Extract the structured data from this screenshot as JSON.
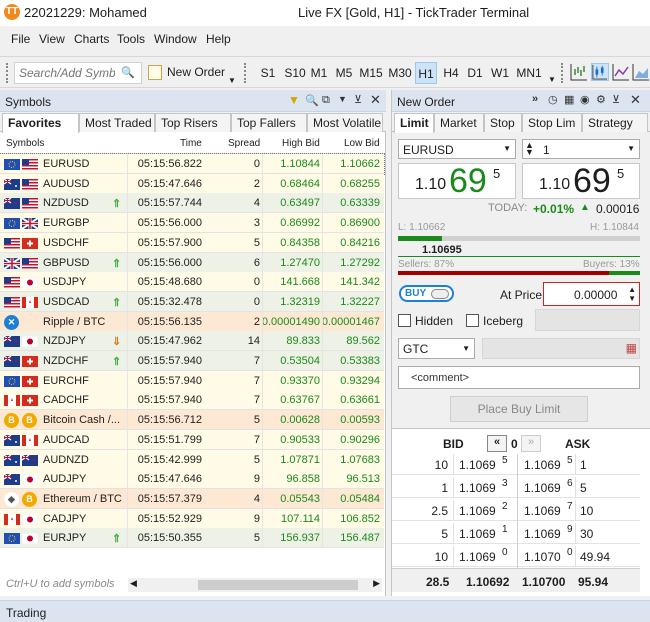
{
  "window": {
    "account": "22021229: Mohamed",
    "title": "Live FX [Gold, H1] - TickTrader Terminal"
  },
  "menu": [
    "File",
    "View",
    "Charts",
    "Tools",
    "Window",
    "Help"
  ],
  "toolbar": {
    "search_placeholder": "Search/Add Symbols",
    "new_order": "New Order",
    "timeframes": [
      "S1",
      "S10",
      "M1",
      "M5",
      "M15",
      "M30",
      "H1",
      "H4",
      "D1",
      "W1",
      "MN1"
    ],
    "active_timeframe": "H1"
  },
  "symbols_panel": {
    "title": "Symbols",
    "tabs": [
      "Favorites",
      "Most Traded",
      "Top Risers",
      "Top Fallers",
      "Most Volatile"
    ],
    "active_tab": "Favorites",
    "columns": [
      "Symbols",
      "Time",
      "Spread",
      "High Bid",
      "Low Bid"
    ],
    "rows": [
      {
        "symbol": "EURUSD",
        "time": "05:15:56.822",
        "spread": "0",
        "high": "1.10844",
        "low": "1.10662",
        "flags": [
          "eu",
          "us"
        ],
        "trend": "",
        "bg": "#fffbe6"
      },
      {
        "symbol": "AUDUSD",
        "time": "05:15:47.646",
        "spread": "2",
        "high": "0.68464",
        "low": "0.68255",
        "flags": [
          "au",
          "us"
        ],
        "trend": "",
        "bg": "#fffbe6"
      },
      {
        "symbol": "NZDUSD",
        "time": "05:15:57.744",
        "spread": "4",
        "high": "0.63497",
        "low": "0.63339",
        "flags": [
          "nz",
          "us"
        ],
        "trend": "up",
        "bg": "#eef1e6"
      },
      {
        "symbol": "EURGBP",
        "time": "05:15:56.000",
        "spread": "3",
        "high": "0.86992",
        "low": "0.86900",
        "flags": [
          "eu",
          "gb"
        ],
        "trend": "",
        "bg": "#fffbe6"
      },
      {
        "symbol": "USDCHF",
        "time": "05:15:57.900",
        "spread": "5",
        "high": "0.84358",
        "low": "0.84216",
        "flags": [
          "us",
          "ch"
        ],
        "trend": "",
        "bg": "#fffbe6"
      },
      {
        "symbol": "GBPUSD",
        "time": "05:15:56.000",
        "spread": "6",
        "high": "1.27470",
        "low": "1.27292",
        "flags": [
          "gb",
          "us"
        ],
        "trend": "up",
        "bg": "#eef1e6"
      },
      {
        "symbol": "USDJPY",
        "time": "05:15:48.680",
        "spread": "0",
        "high": "141.668",
        "low": "141.342",
        "flags": [
          "us",
          "jp"
        ],
        "trend": "",
        "bg": "#fffbe6"
      },
      {
        "symbol": "USDCAD",
        "time": "05:15:32.478",
        "spread": "0",
        "high": "1.32319",
        "low": "1.32227",
        "flags": [
          "us",
          "ca"
        ],
        "trend": "up",
        "bg": "#eef1e6"
      },
      {
        "symbol": "Ripple / BTC",
        "time": "05:15:56.135",
        "spread": "2",
        "high": "0.00001490",
        "low": "0.00001467",
        "flags": [
          "xrp"
        ],
        "trend": "",
        "bg": "#fde8d4"
      },
      {
        "symbol": "NZDJPY",
        "time": "05:15:47.962",
        "spread": "14",
        "high": "89.833",
        "low": "89.562",
        "flags": [
          "nz",
          "jp"
        ],
        "trend": "down",
        "bg": "#eef1e6"
      },
      {
        "symbol": "NZDCHF",
        "time": "05:15:57.940",
        "spread": "7",
        "high": "0.53504",
        "low": "0.53383",
        "flags": [
          "nz",
          "ch"
        ],
        "trend": "up",
        "bg": "#eef1e6"
      },
      {
        "symbol": "EURCHF",
        "time": "05:15:57.940",
        "spread": "7",
        "high": "0.93370",
        "low": "0.93294",
        "flags": [
          "eu",
          "ch"
        ],
        "trend": "",
        "bg": "#fffbe6"
      },
      {
        "symbol": "CADCHF",
        "time": "05:15:57.940",
        "spread": "7",
        "high": "0.63767",
        "low": "0.63661",
        "flags": [
          "ca",
          "ch"
        ],
        "trend": "",
        "bg": "#fffbe6"
      },
      {
        "symbol": "Bitcoin Cash /...",
        "time": "05:15:56.712",
        "spread": "5",
        "high": "0.00628",
        "low": "0.00593",
        "flags": [
          "bch",
          "btc"
        ],
        "trend": "",
        "bg": "#fde8d4"
      },
      {
        "symbol": "AUDCAD",
        "time": "05:15:51.799",
        "spread": "7",
        "high": "0.90533",
        "low": "0.90296",
        "flags": [
          "au",
          "ca"
        ],
        "trend": "",
        "bg": "#fffbe6"
      },
      {
        "symbol": "AUDNZD",
        "time": "05:15:42.999",
        "spread": "5",
        "high": "1.07871",
        "low": "1.07683",
        "flags": [
          "au",
          "nz"
        ],
        "trend": "",
        "bg": "#fffbe6"
      },
      {
        "symbol": "AUDJPY",
        "time": "05:15:47.646",
        "spread": "9",
        "high": "96.858",
        "low": "96.513",
        "flags": [
          "au",
          "jp"
        ],
        "trend": "",
        "bg": "#fffbe6"
      },
      {
        "symbol": "Ethereum / BTC",
        "time": "05:15:57.379",
        "spread": "4",
        "high": "0.05543",
        "low": "0.05484",
        "flags": [
          "eth",
          "btc"
        ],
        "trend": "",
        "bg": "#fde8d4"
      },
      {
        "symbol": "CADJPY",
        "time": "05:15:52.929",
        "spread": "9",
        "high": "107.114",
        "low": "106.852",
        "flags": [
          "ca",
          "jp"
        ],
        "trend": "",
        "bg": "#fffbe6"
      },
      {
        "symbol": "EURJPY",
        "time": "05:15:50.355",
        "spread": "5",
        "high": "156.937",
        "low": "156.487",
        "flags": [
          "eu",
          "jp"
        ],
        "trend": "up",
        "bg": "#eef1e6"
      }
    ],
    "hint": "Ctrl+U to add symbols"
  },
  "order_panel": {
    "title": "New Order",
    "tabs": [
      "Limit",
      "Market",
      "Stop",
      "Stop Lim",
      "Strategy"
    ],
    "active_tab": "Limit",
    "symbol": "EURUSD",
    "quantity": "1",
    "bid": {
      "pre": "1.10",
      "big": "69",
      "sup": "5"
    },
    "ask": {
      "pre": "1.10",
      "big": "69",
      "sup": "5"
    },
    "today_label": "TODAY:",
    "today_pct": "+0.01%",
    "today_abs": "0.00016",
    "low_label": "L: 1.10662",
    "high_label": "H: 1.10844",
    "current_price": "1.10695",
    "current_fraction": 0.18,
    "sellers": "Sellers: 87%",
    "buyers": "Buyers: 13%",
    "sellers_fraction": 0.87,
    "buy_toggle": "BUY",
    "at_price_label": "At Price:",
    "at_price_value": "0.00000",
    "hidden_label": "Hidden",
    "iceberg_label": "Iceberg",
    "expiry": "GTC",
    "comment_placeholder": "<comment>",
    "place_button": "Place Buy Limit"
  },
  "order_book": {
    "bid_header": "BID",
    "ask_header": "ASK",
    "depth": "0",
    "rows": [
      {
        "bid_vol": "10",
        "bid_pre": "1.1069",
        "bid_sup": "5",
        "ask_pre": "1.1069",
        "ask_sup": "5",
        "ask_vol": "1"
      },
      {
        "bid_vol": "1",
        "bid_pre": "1.1069",
        "bid_sup": "3",
        "ask_pre": "1.1069",
        "ask_sup": "6",
        "ask_vol": "5"
      },
      {
        "bid_vol": "2.5",
        "bid_pre": "1.1069",
        "bid_sup": "2",
        "ask_pre": "1.1069",
        "ask_sup": "7",
        "ask_vol": "10"
      },
      {
        "bid_vol": "5",
        "bid_pre": "1.1069",
        "bid_sup": "1",
        "ask_pre": "1.1069",
        "ask_sup": "9",
        "ask_vol": "30"
      },
      {
        "bid_vol": "10",
        "bid_pre": "1.1069",
        "bid_sup": "0",
        "ask_pre": "1.1070",
        "ask_sup": "0",
        "ask_vol": "49.94"
      }
    ],
    "totals": {
      "bid_vol": "28.5",
      "bid_avg": "1.10692",
      "ask_avg": "1.10700",
      "ask_vol": "95.94"
    }
  },
  "status": {
    "text": "Trading"
  },
  "colors": {
    "accent": "#1e7fd6",
    "green": "#1a8a1a",
    "red": "#a00000",
    "panel_header": "#dbe4ef"
  }
}
